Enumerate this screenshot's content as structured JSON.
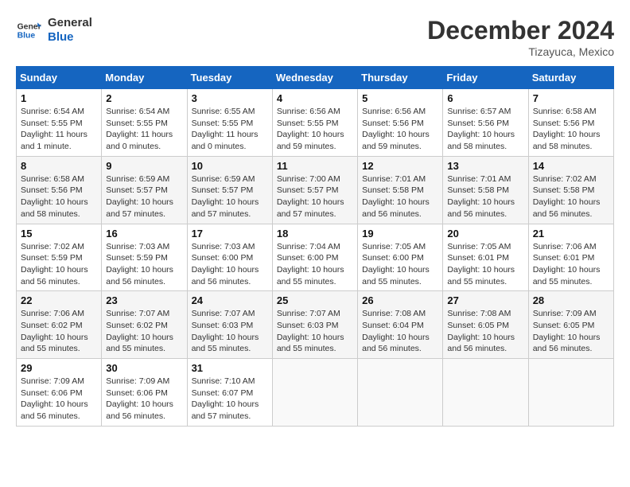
{
  "logo": {
    "line1": "General",
    "line2": "Blue"
  },
  "title": "December 2024",
  "location": "Tizayuca, Mexico",
  "weekdays": [
    "Sunday",
    "Monday",
    "Tuesday",
    "Wednesday",
    "Thursday",
    "Friday",
    "Saturday"
  ],
  "weeks": [
    [
      {
        "day": "1",
        "info": "Sunrise: 6:54 AM\nSunset: 5:55 PM\nDaylight: 11 hours\nand 1 minute."
      },
      {
        "day": "2",
        "info": "Sunrise: 6:54 AM\nSunset: 5:55 PM\nDaylight: 11 hours\nand 0 minutes."
      },
      {
        "day": "3",
        "info": "Sunrise: 6:55 AM\nSunset: 5:55 PM\nDaylight: 11 hours\nand 0 minutes."
      },
      {
        "day": "4",
        "info": "Sunrise: 6:56 AM\nSunset: 5:55 PM\nDaylight: 10 hours\nand 59 minutes."
      },
      {
        "day": "5",
        "info": "Sunrise: 6:56 AM\nSunset: 5:56 PM\nDaylight: 10 hours\nand 59 minutes."
      },
      {
        "day": "6",
        "info": "Sunrise: 6:57 AM\nSunset: 5:56 PM\nDaylight: 10 hours\nand 58 minutes."
      },
      {
        "day": "7",
        "info": "Sunrise: 6:58 AM\nSunset: 5:56 PM\nDaylight: 10 hours\nand 58 minutes."
      }
    ],
    [
      {
        "day": "8",
        "info": "Sunrise: 6:58 AM\nSunset: 5:56 PM\nDaylight: 10 hours\nand 58 minutes."
      },
      {
        "day": "9",
        "info": "Sunrise: 6:59 AM\nSunset: 5:57 PM\nDaylight: 10 hours\nand 57 minutes."
      },
      {
        "day": "10",
        "info": "Sunrise: 6:59 AM\nSunset: 5:57 PM\nDaylight: 10 hours\nand 57 minutes."
      },
      {
        "day": "11",
        "info": "Sunrise: 7:00 AM\nSunset: 5:57 PM\nDaylight: 10 hours\nand 57 minutes."
      },
      {
        "day": "12",
        "info": "Sunrise: 7:01 AM\nSunset: 5:58 PM\nDaylight: 10 hours\nand 56 minutes."
      },
      {
        "day": "13",
        "info": "Sunrise: 7:01 AM\nSunset: 5:58 PM\nDaylight: 10 hours\nand 56 minutes."
      },
      {
        "day": "14",
        "info": "Sunrise: 7:02 AM\nSunset: 5:58 PM\nDaylight: 10 hours\nand 56 minutes."
      }
    ],
    [
      {
        "day": "15",
        "info": "Sunrise: 7:02 AM\nSunset: 5:59 PM\nDaylight: 10 hours\nand 56 minutes."
      },
      {
        "day": "16",
        "info": "Sunrise: 7:03 AM\nSunset: 5:59 PM\nDaylight: 10 hours\nand 56 minutes."
      },
      {
        "day": "17",
        "info": "Sunrise: 7:03 AM\nSunset: 6:00 PM\nDaylight: 10 hours\nand 56 minutes."
      },
      {
        "day": "18",
        "info": "Sunrise: 7:04 AM\nSunset: 6:00 PM\nDaylight: 10 hours\nand 55 minutes."
      },
      {
        "day": "19",
        "info": "Sunrise: 7:05 AM\nSunset: 6:00 PM\nDaylight: 10 hours\nand 55 minutes."
      },
      {
        "day": "20",
        "info": "Sunrise: 7:05 AM\nSunset: 6:01 PM\nDaylight: 10 hours\nand 55 minutes."
      },
      {
        "day": "21",
        "info": "Sunrise: 7:06 AM\nSunset: 6:01 PM\nDaylight: 10 hours\nand 55 minutes."
      }
    ],
    [
      {
        "day": "22",
        "info": "Sunrise: 7:06 AM\nSunset: 6:02 PM\nDaylight: 10 hours\nand 55 minutes."
      },
      {
        "day": "23",
        "info": "Sunrise: 7:07 AM\nSunset: 6:02 PM\nDaylight: 10 hours\nand 55 minutes."
      },
      {
        "day": "24",
        "info": "Sunrise: 7:07 AM\nSunset: 6:03 PM\nDaylight: 10 hours\nand 55 minutes."
      },
      {
        "day": "25",
        "info": "Sunrise: 7:07 AM\nSunset: 6:03 PM\nDaylight: 10 hours\nand 55 minutes."
      },
      {
        "day": "26",
        "info": "Sunrise: 7:08 AM\nSunset: 6:04 PM\nDaylight: 10 hours\nand 56 minutes."
      },
      {
        "day": "27",
        "info": "Sunrise: 7:08 AM\nSunset: 6:05 PM\nDaylight: 10 hours\nand 56 minutes."
      },
      {
        "day": "28",
        "info": "Sunrise: 7:09 AM\nSunset: 6:05 PM\nDaylight: 10 hours\nand 56 minutes."
      }
    ],
    [
      {
        "day": "29",
        "info": "Sunrise: 7:09 AM\nSunset: 6:06 PM\nDaylight: 10 hours\nand 56 minutes."
      },
      {
        "day": "30",
        "info": "Sunrise: 7:09 AM\nSunset: 6:06 PM\nDaylight: 10 hours\nand 56 minutes."
      },
      {
        "day": "31",
        "info": "Sunrise: 7:10 AM\nSunset: 6:07 PM\nDaylight: 10 hours\nand 57 minutes."
      },
      {
        "day": "",
        "info": ""
      },
      {
        "day": "",
        "info": ""
      },
      {
        "day": "",
        "info": ""
      },
      {
        "day": "",
        "info": ""
      }
    ]
  ]
}
